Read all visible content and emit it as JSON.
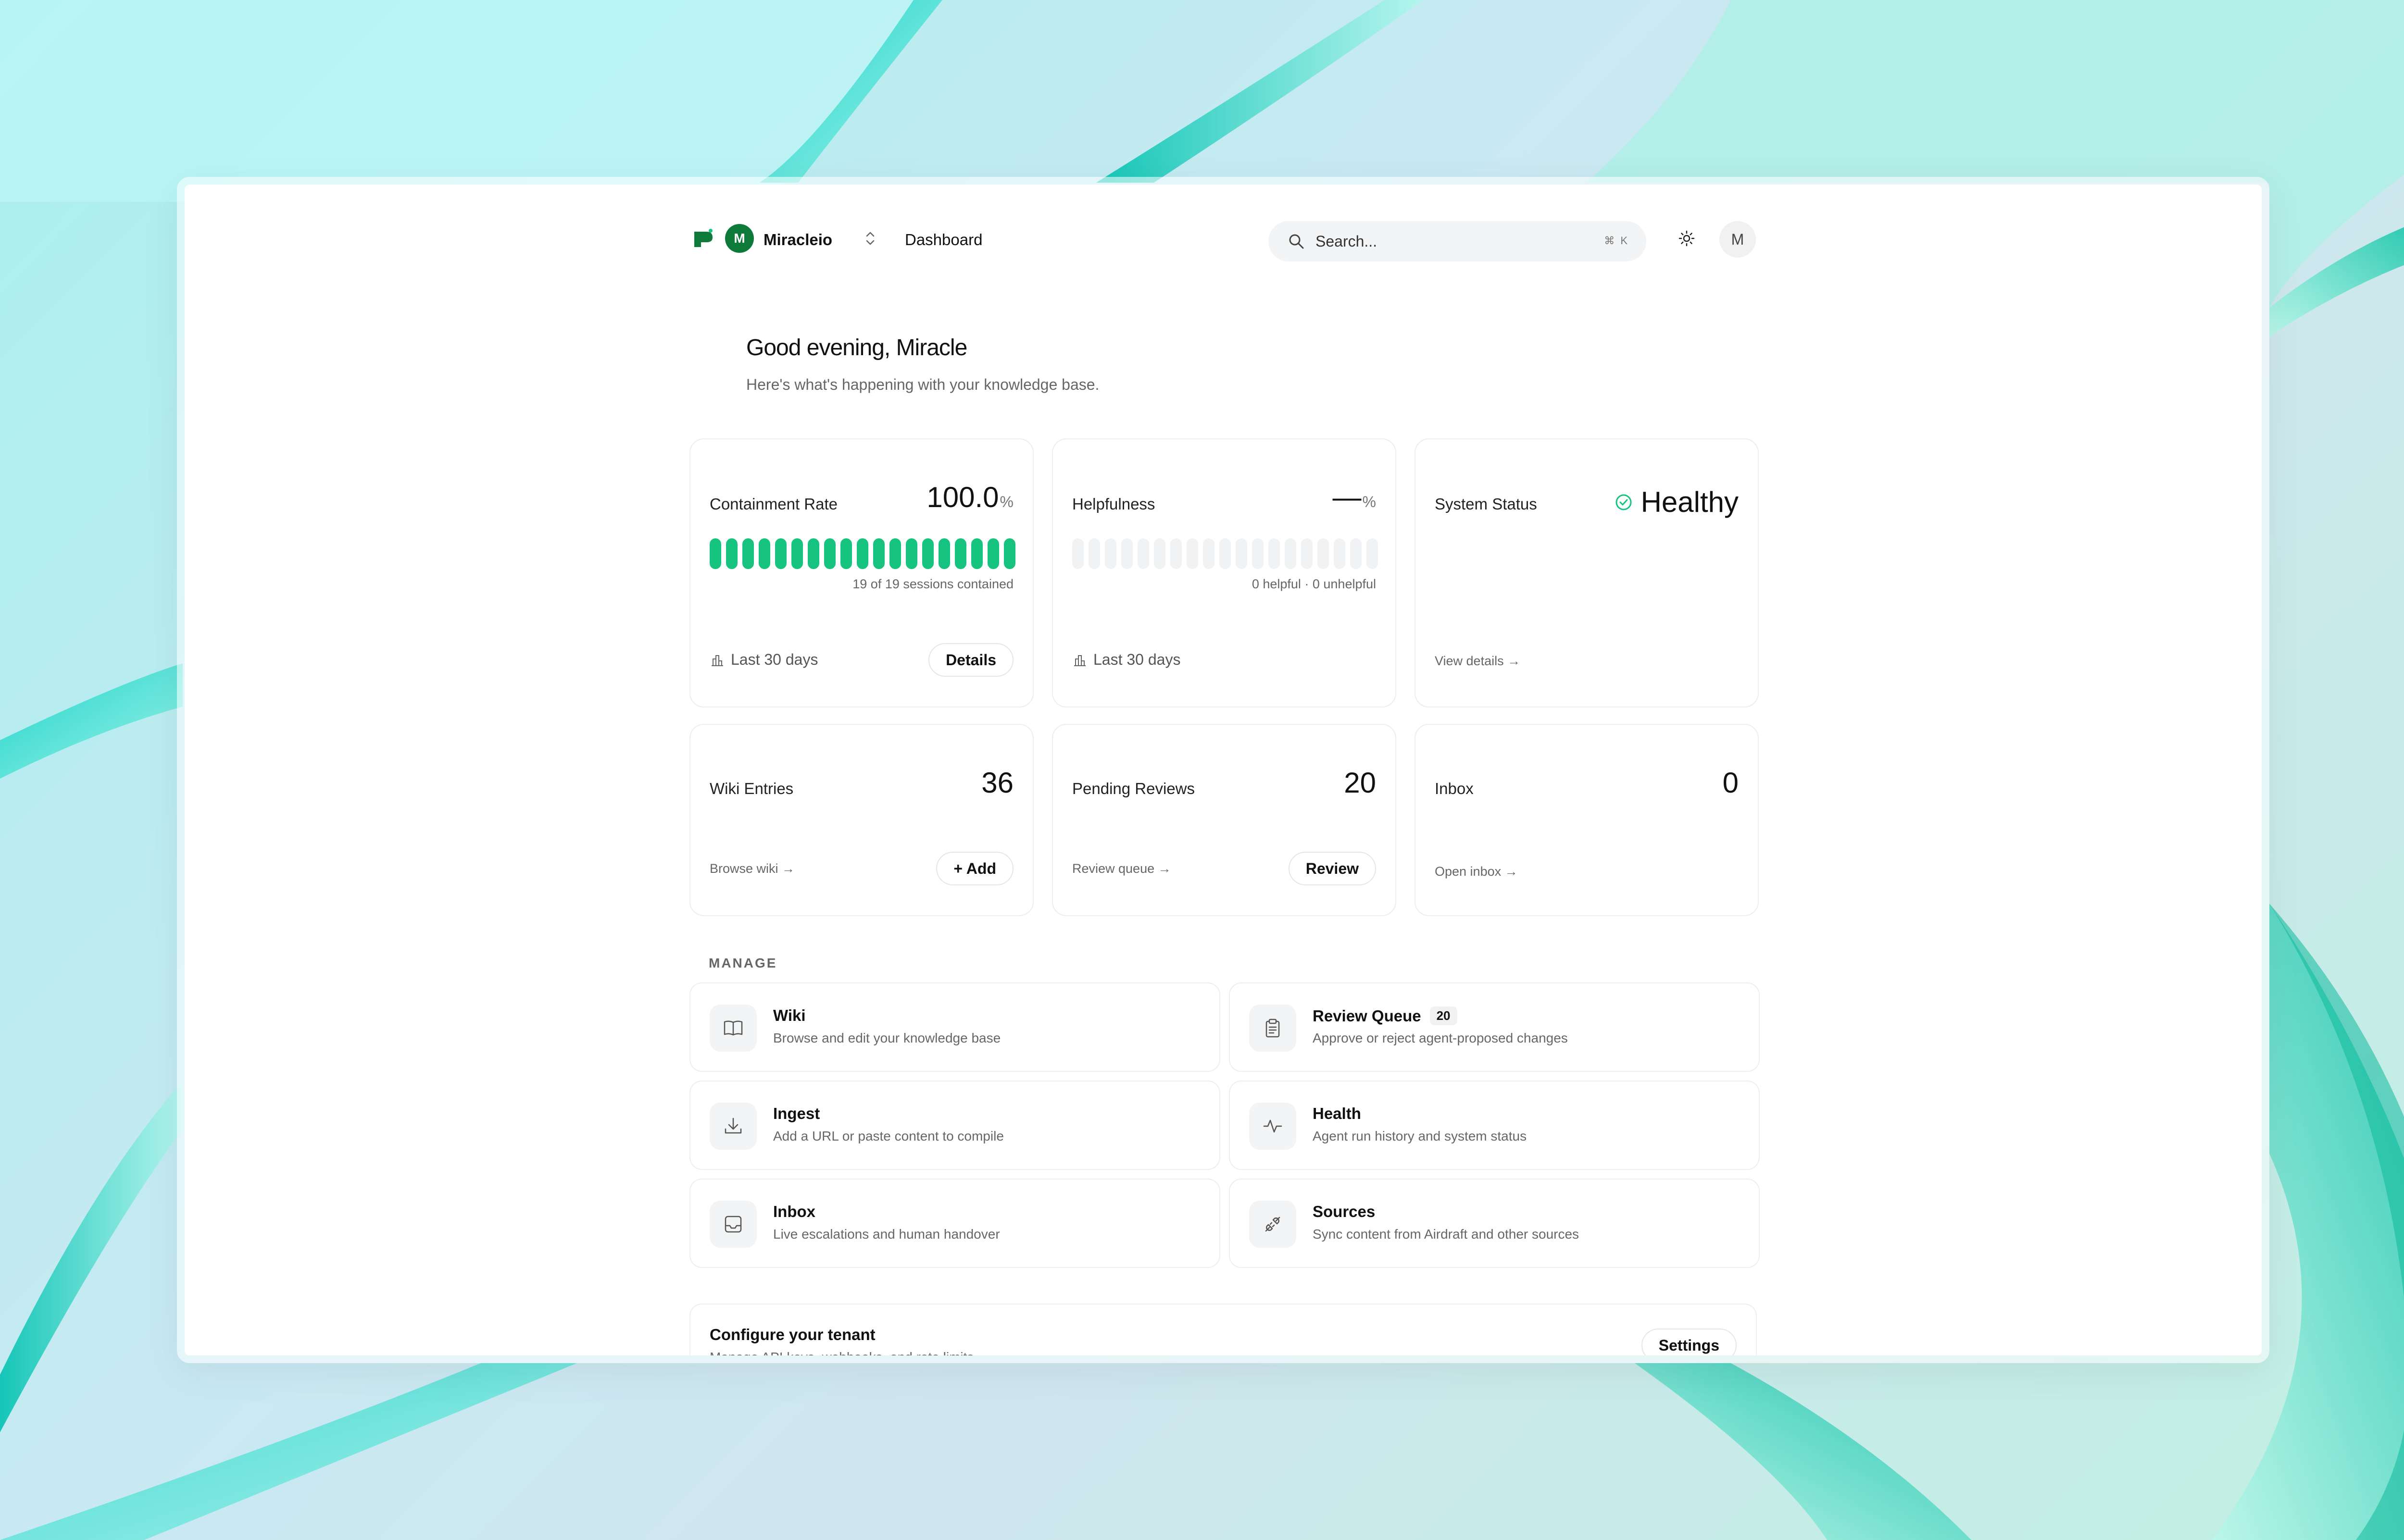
{
  "org": {
    "initial": "M",
    "name": "Miracleio"
  },
  "nav": {
    "dashboard": "Dashboard"
  },
  "search": {
    "placeholder": "Search...",
    "shortcut": "⌘ K"
  },
  "user": {
    "initial": "M"
  },
  "greeting": {
    "title": "Good evening, Miracle",
    "subtitle": "Here's what's happening with your knowledge base."
  },
  "colors": {
    "accent": "#16c47f",
    "bar_empty": "#f1f2f3",
    "brand": "#0e7a3a"
  },
  "stats": {
    "containment": {
      "label": "Containment Rate",
      "value": "100.0",
      "unit": "%",
      "contained": 19,
      "total": 19,
      "caption": "19 of 19 sessions contained",
      "period": "Last 30 days",
      "button": "Details"
    },
    "helpfulness": {
      "label": "Helpfulness",
      "value": "—",
      "unit": "%",
      "caption": "0 helpful · 0 unhelpful",
      "period": "Last 30 days"
    },
    "system": {
      "label": "System Status",
      "value": "Healthy",
      "link": "View details →"
    },
    "wiki": {
      "label": "Wiki Entries",
      "value": "36",
      "link": "Browse wiki →",
      "button": "+ Add"
    },
    "reviews": {
      "label": "Pending Reviews",
      "value": "20",
      "link": "Review queue →",
      "button": "Review"
    },
    "inbox": {
      "label": "Inbox",
      "value": "0",
      "link": "Open inbox →"
    }
  },
  "manage": {
    "label": "MANAGE",
    "items": [
      {
        "title": "Wiki",
        "desc": "Browse and edit your knowledge base",
        "icon": "book-icon"
      },
      {
        "title": "Review Queue",
        "badge": "20",
        "desc": "Approve or reject agent-proposed changes",
        "icon": "clipboard-icon"
      },
      {
        "title": "Ingest",
        "desc": "Add a URL or paste content to compile",
        "icon": "download-icon"
      },
      {
        "title": "Health",
        "desc": "Agent run history and system status",
        "icon": "activity-icon"
      },
      {
        "title": "Inbox",
        "desc": "Live escalations and human handover",
        "icon": "inbox-icon"
      },
      {
        "title": "Sources",
        "desc": "Sync content from Airdraft and other sources",
        "icon": "plug-icon"
      }
    ]
  },
  "config": {
    "title": "Configure your tenant",
    "desc": "Manage API keys, webhooks, and rate limits",
    "button": "Settings"
  }
}
